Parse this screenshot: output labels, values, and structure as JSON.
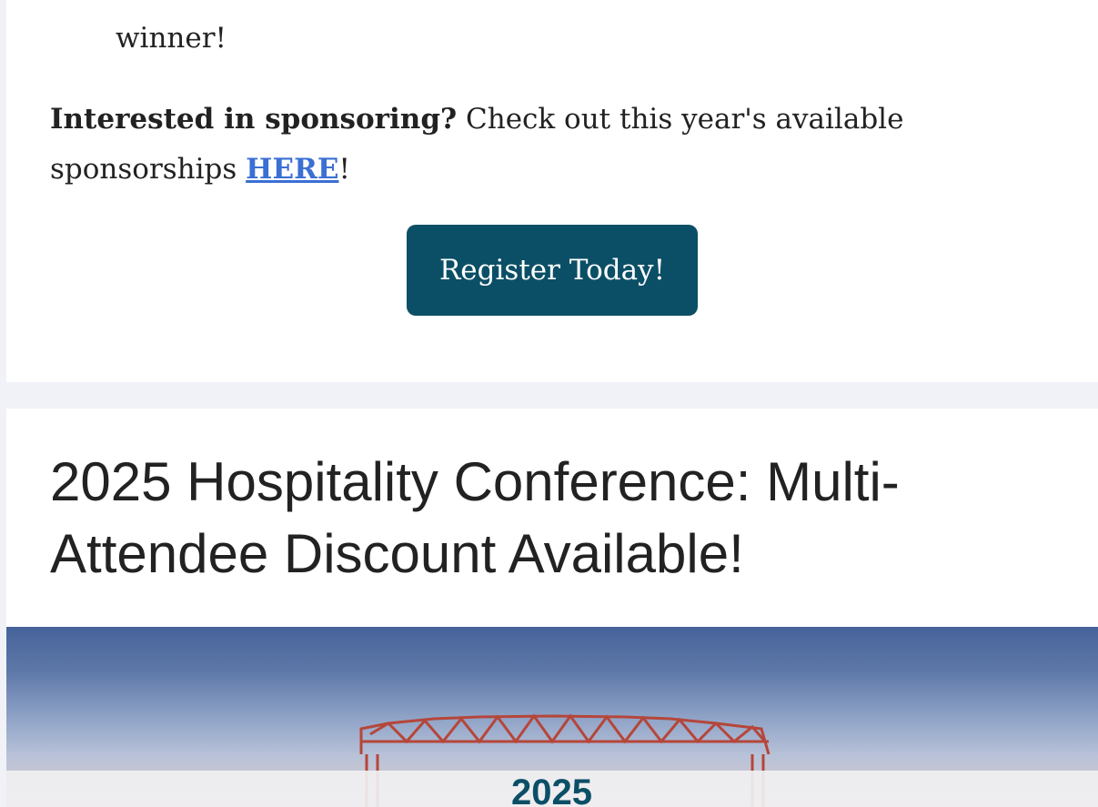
{
  "top_card": {
    "winner_text": "winner!",
    "sponsor_lead": "Interested in sponsoring?",
    "sponsor_text": " Check out this year's available sponsorships ",
    "sponsor_link": "HERE",
    "sponsor_end": "!",
    "register_label": "Register Today!"
  },
  "bottom_card": {
    "title": "2025 Hospitality Conference: Multi-Attendee Discount Available!",
    "hero_year": "2025"
  },
  "colors": {
    "button_bg": "#0b4f66",
    "link": "#3b6fd4",
    "page_bg": "#f1f2f7"
  }
}
